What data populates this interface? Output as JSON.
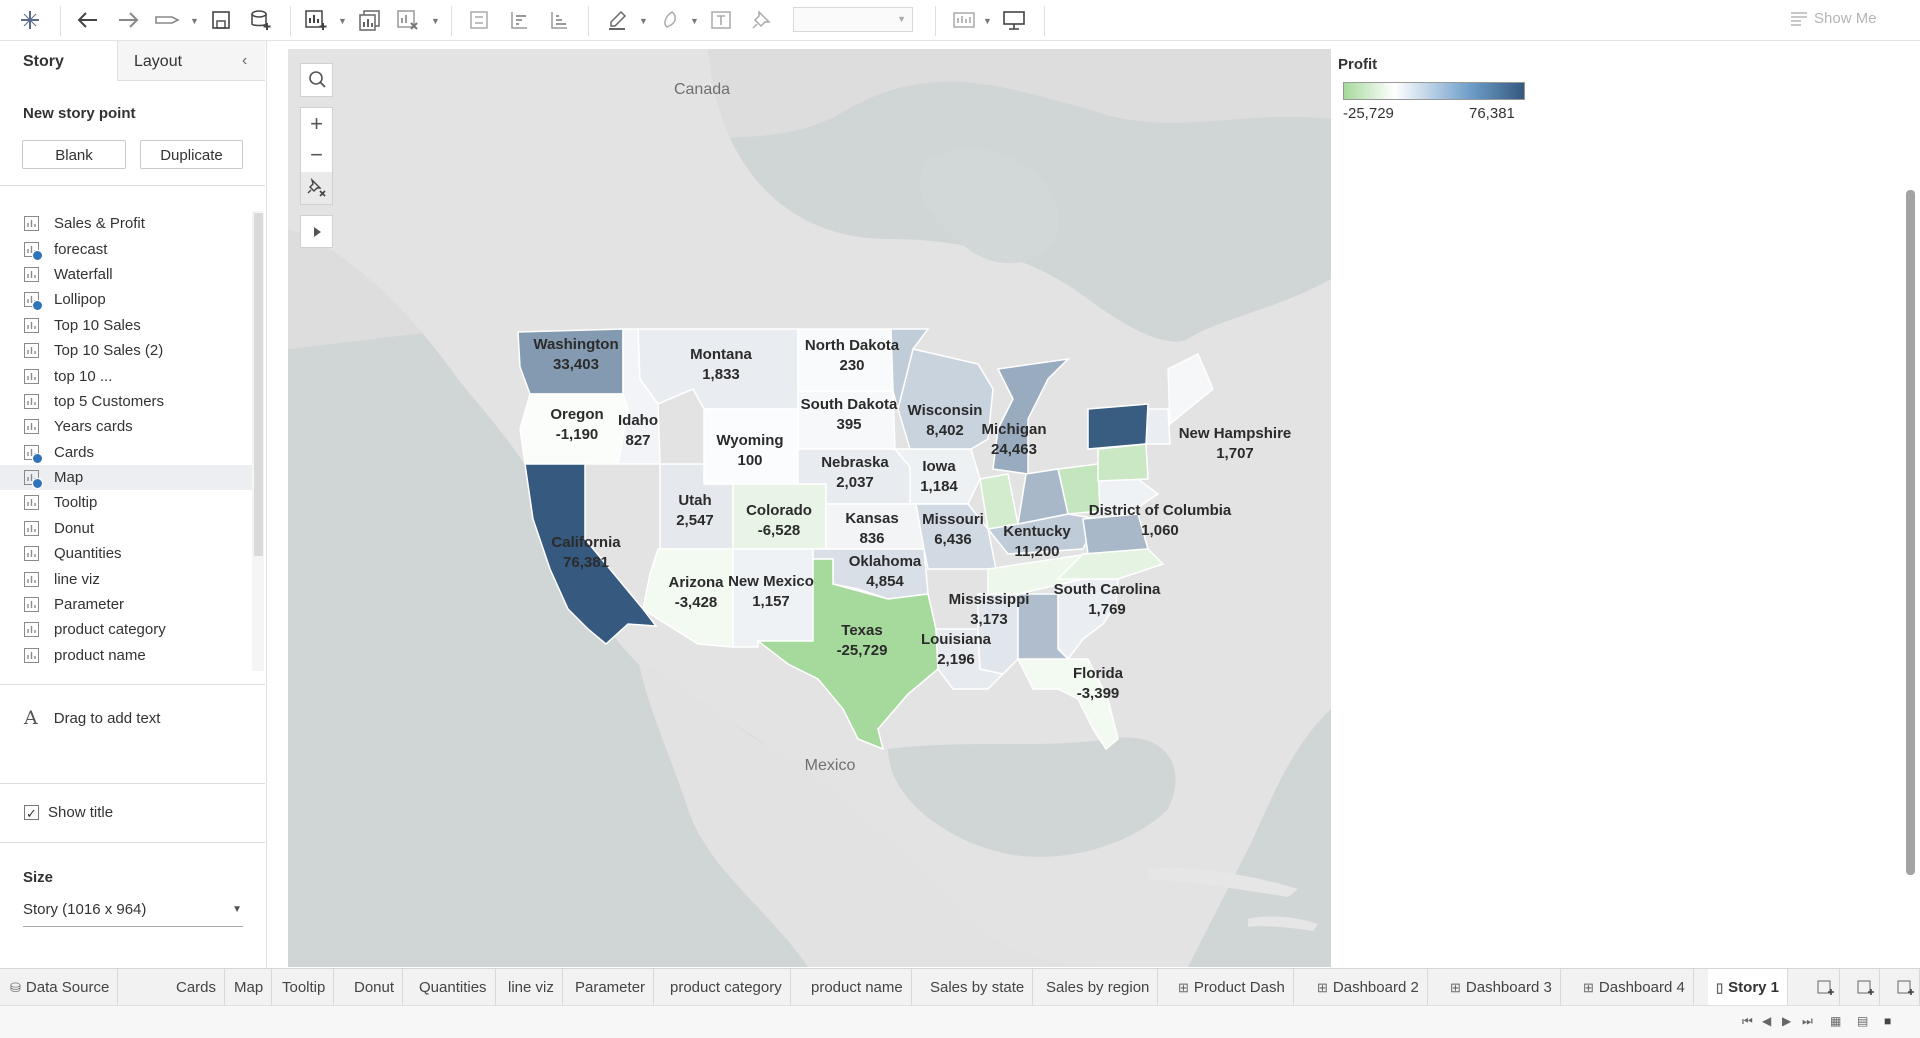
{
  "toolbar": {
    "icons": [
      "tableau-logo-icon",
      "undo-icon",
      "redo-icon",
      "replay-icon",
      "save-icon",
      "new-datasource-icon",
      "new-worksheet-icon",
      "duplicate-sheet-icon",
      "clear-sheet-icon",
      "swap-icon",
      "sort-ascending-icon",
      "sort-descending-icon",
      "highlight-icon",
      "group-icon",
      "label-icon",
      "pin-icon",
      "fit-icon",
      "presentation-icon"
    ],
    "show_me": "Show Me"
  },
  "left_panel": {
    "tabs": [
      "Story",
      "Layout"
    ],
    "new_story_point": "New story point",
    "blank_button": "Blank",
    "duplicate_button": "Duplicate",
    "sheets": [
      {
        "name": "Sales & Profit",
        "badge": false,
        "selected": false
      },
      {
        "name": "forecast",
        "badge": true,
        "selected": false
      },
      {
        "name": "Waterfall",
        "badge": false,
        "selected": false
      },
      {
        "name": "Lollipop",
        "badge": true,
        "selected": false
      },
      {
        "name": "Top 10 Sales",
        "badge": false,
        "selected": false
      },
      {
        "name": "Top 10 Sales (2)",
        "badge": false,
        "selected": false
      },
      {
        "name": "top 10 ...",
        "badge": false,
        "selected": false
      },
      {
        "name": "top 5 Customers",
        "badge": false,
        "selected": false
      },
      {
        "name": "Years cards",
        "badge": false,
        "selected": false
      },
      {
        "name": "Cards",
        "badge": true,
        "selected": false
      },
      {
        "name": "Map",
        "badge": true,
        "selected": true
      },
      {
        "name": "Tooltip",
        "badge": false,
        "selected": false
      },
      {
        "name": "Donut",
        "badge": false,
        "selected": false
      },
      {
        "name": "Quantities",
        "badge": false,
        "selected": false
      },
      {
        "name": "line viz",
        "badge": false,
        "selected": false
      },
      {
        "name": "Parameter",
        "badge": false,
        "selected": false
      },
      {
        "name": "product category",
        "badge": false,
        "selected": false
      },
      {
        "name": "product name",
        "badge": false,
        "selected": false
      }
    ],
    "drag_text": "Drag to add text",
    "show_title": "Show title",
    "show_title_checked": true,
    "size_label": "Size",
    "size_value": "Story (1016 x 964)"
  },
  "map": {
    "labels": {
      "canada": "Canada",
      "mexico": "Mexico"
    },
    "states": [
      {
        "name": "Washington",
        "profit": "33,403"
      },
      {
        "name": "Oregon",
        "profit": "-1,190"
      },
      {
        "name": "California",
        "profit": "76,381"
      },
      {
        "name": "Idaho",
        "profit": "827"
      },
      {
        "name": "Montana",
        "profit": "1,833"
      },
      {
        "name": "Wyoming",
        "profit": "100"
      },
      {
        "name": "Utah",
        "profit": "2,547"
      },
      {
        "name": "Arizona",
        "profit": "-3,428"
      },
      {
        "name": "New Mexico",
        "profit": "1,157"
      },
      {
        "name": "Colorado",
        "profit": "-6,528"
      },
      {
        "name": "North Dakota",
        "profit": "230"
      },
      {
        "name": "South Dakota",
        "profit": "395"
      },
      {
        "name": "Nebraska",
        "profit": "2,037"
      },
      {
        "name": "Kansas",
        "profit": "836"
      },
      {
        "name": "Oklahoma",
        "profit": "4,854"
      },
      {
        "name": "Texas",
        "profit": "-25,729"
      },
      {
        "name": "Iowa",
        "profit": "1,184"
      },
      {
        "name": "Missouri",
        "profit": "6,436"
      },
      {
        "name": "Louisiana",
        "profit": "2,196"
      },
      {
        "name": "Mississippi",
        "profit": "3,173"
      },
      {
        "name": "Wisconsin",
        "profit": "8,402"
      },
      {
        "name": "Michigan",
        "profit": "24,463"
      },
      {
        "name": "Kentucky",
        "profit": "11,200"
      },
      {
        "name": "South Carolina",
        "profit": "1,769"
      },
      {
        "name": "Florida",
        "profit": "-3,399"
      },
      {
        "name": "District of Columbia",
        "profit": "1,060"
      },
      {
        "name": "New Hampshire",
        "profit": "1,707"
      }
    ]
  },
  "legend": {
    "title": "Profit",
    "min": "-25,729",
    "max": "76,381",
    "color_low": "#a6d99c",
    "color_mid": "#ffffff",
    "color_high": "#35597f"
  },
  "bottom_tabs": [
    {
      "label": "Data Source",
      "icon": "datasource-icon",
      "active": false
    },
    {
      "label": "Cards",
      "icon": "",
      "active": false
    },
    {
      "label": "Map",
      "icon": "",
      "active": false
    },
    {
      "label": "Tooltip",
      "icon": "",
      "active": false
    },
    {
      "label": "Donut",
      "icon": "",
      "active": false
    },
    {
      "label": "Quantities",
      "icon": "",
      "active": false
    },
    {
      "label": "line viz",
      "icon": "",
      "active": false
    },
    {
      "label": "Parameter",
      "icon": "",
      "active": false
    },
    {
      "label": "product category",
      "icon": "",
      "active": false
    },
    {
      "label": "product name",
      "icon": "",
      "active": false
    },
    {
      "label": "Sales by state",
      "icon": "",
      "active": false
    },
    {
      "label": "Sales by region",
      "icon": "",
      "active": false
    },
    {
      "label": "Product Dash",
      "icon": "dashboard-icon",
      "active": false
    },
    {
      "label": "Dashboard 2",
      "icon": "dashboard-icon",
      "active": false
    },
    {
      "label": "Dashboard 3",
      "icon": "dashboard-icon",
      "active": false
    },
    {
      "label": "Dashboard 4",
      "icon": "dashboard-icon",
      "active": false
    },
    {
      "label": "Story 1",
      "icon": "story-icon",
      "active": true
    }
  ]
}
